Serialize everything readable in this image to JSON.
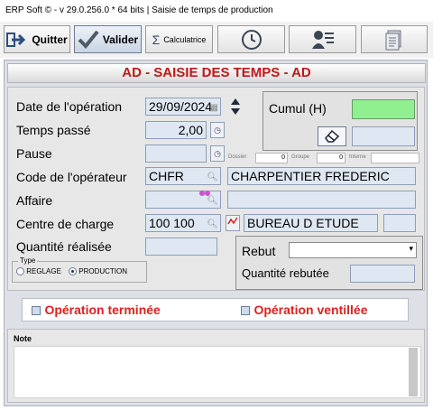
{
  "window": {
    "title": "ERP Soft © - v 29.0.256.0 * 64 bits | Saisie de temps de production"
  },
  "toolbar": {
    "quit": "Quitter",
    "validate": "Valider",
    "calc": "Calculatrice"
  },
  "form": {
    "header": "AD - SAISIE DES TEMPS - AD",
    "date_label": "Date de l'opération",
    "date_value": "29/09/2024",
    "temps_label": "Temps passé",
    "temps_value": "2,00",
    "pause_label": "Pause",
    "pause_value": "",
    "cumul_label": "Cumul (H)",
    "dossier_label": "Dossier",
    "dossier_value": "0",
    "groupe_label": "Groupe",
    "groupe_value": "0",
    "interne_label": "Interne",
    "operateur_label": "Code de l'opérateur",
    "operateur_code": "CHFR",
    "operateur_name": "CHARPENTIER FREDERIC",
    "affaire_label": "Affaire",
    "affaire_value": "",
    "centre_label": "Centre de charge",
    "centre_code": "100 100",
    "centre_name": "BUREAU D ETUDE",
    "quantite_label": "Quantité réalisée",
    "quantite_value": "",
    "type_label": "Type",
    "reglage_label": "REGLAGE",
    "production_label": "PRODUCTION",
    "rebut_label": "Rebut",
    "rebut_value": "",
    "qte_rebut_label": "Quantité rebutée",
    "qte_rebut_value": ""
  },
  "options": {
    "terminee": "Opération terminée",
    "ventillee": "Opération ventillée"
  },
  "note": {
    "label": "Note",
    "value": ""
  },
  "colors": {
    "header_text": "#c01818",
    "accent_green": "#90f090",
    "option_red": "#e02020",
    "link_pink": "#d050d0"
  }
}
